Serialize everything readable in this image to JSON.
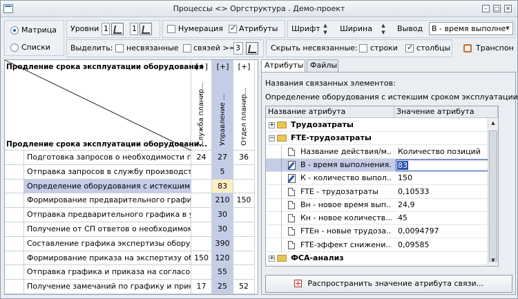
{
  "window": {
    "title": "Процессы <> Оргструктура . Демо-проект"
  },
  "toolbar": {
    "view_matrix": "Матрица",
    "view_lists": "Списки",
    "levels_label": "Уровни",
    "levels_value1": "1",
    "levels_value2": "1",
    "numbering_label": "Нумерация",
    "attributes_label": "Атрибуты",
    "font_label": "Шрифт",
    "width_label": "Ширина",
    "output_label": "Вывод",
    "output_value": "В - время выполне",
    "select_label": "Выделить:",
    "unlinked_label": "несвязанные",
    "links_ge_label": "связей >=",
    "links_ge_value": "3",
    "hide_unlinked_label": "Скрыть несвязанные:",
    "rows_label": "строки",
    "cols_label": "столбцы",
    "transpose_label": "Транспон"
  },
  "matrix": {
    "corner_top": "Продление срока эксплуатации оборудования",
    "corner_bottom": "Продление срока эксплуатации оборудовани...",
    "expand_mark": "[+]",
    "columns": [
      {
        "label": "Служба планир...",
        "highlight": false
      },
      {
        "label": "Управление ...",
        "highlight": true
      },
      {
        "label": "Отдел планир...",
        "highlight": false
      }
    ],
    "rows": [
      {
        "label": "Подготовка запросов о необходимости прод...",
        "values": [
          "24",
          "27",
          "36"
        ]
      },
      {
        "label": "Отправка запросов в службу производства ...",
        "values": [
          "",
          "5",
          ""
        ]
      },
      {
        "label": "Определение оборудования с истекшим сро...",
        "values": [
          "",
          "83",
          ""
        ]
      },
      {
        "label": "Формирование предварительного графика п...",
        "values": [
          "",
          "210",
          "150"
        ]
      },
      {
        "label": "Отправка предварительного графика в упра...",
        "values": [
          "",
          "30",
          ""
        ]
      },
      {
        "label": "Получение от СП ответов о необходимом пр...",
        "values": [
          "",
          "30",
          ""
        ]
      },
      {
        "label": "Составление графика экспертизы оборудов...",
        "values": [
          "",
          "390",
          ""
        ]
      },
      {
        "label": "Формирование приказа на экспертизу обору...",
        "values": [
          "150",
          "120",
          ""
        ]
      },
      {
        "label": "Отправка графика и приказа на согласовани...",
        "values": [
          "",
          "55",
          ""
        ]
      },
      {
        "label": "Получение замечаний по графику и приказу",
        "values": [
          "17",
          "25",
          "52"
        ]
      }
    ]
  },
  "right": {
    "tab_attributes": "Атрибуты",
    "tab_files": "Файлы",
    "linked_names_label": "Названия связанных элементов:",
    "linked_element": "Определение оборудования с истекшим сроком эксплуатации",
    "col_name": "Название атрибута",
    "col_value": "Значение атрибута",
    "tree": [
      {
        "kind": "group",
        "expanded": false,
        "name": "Трудозатраты",
        "value": ""
      },
      {
        "kind": "group",
        "expanded": true,
        "name": "FTE-трудозатраты",
        "value": ""
      },
      {
        "kind": "doc",
        "name": "Название действия/м...",
        "value": "Количество позиций"
      },
      {
        "kind": "edit",
        "name": "В - время выполнения...",
        "value": "83"
      },
      {
        "kind": "edit",
        "name": "К - количество выпол...",
        "value": "150"
      },
      {
        "kind": "doc",
        "name": "FTE - трудозатраты",
        "value": "0,10533"
      },
      {
        "kind": "doc",
        "name": "Вн - новое время вып...",
        "value": "24,9"
      },
      {
        "kind": "doc",
        "name": "Кн - новое количеств...",
        "value": "45"
      },
      {
        "kind": "doc",
        "name": "FTEн - новые трудоза...",
        "value": "0,0094797"
      },
      {
        "kind": "doc",
        "name": "FTE-эффект снижени...",
        "value": "0,09585"
      },
      {
        "kind": "group",
        "expanded": false,
        "name": "ФСА-анализ",
        "value": ""
      }
    ],
    "propagate_button": "Распространить значение атрибута связи..."
  }
}
